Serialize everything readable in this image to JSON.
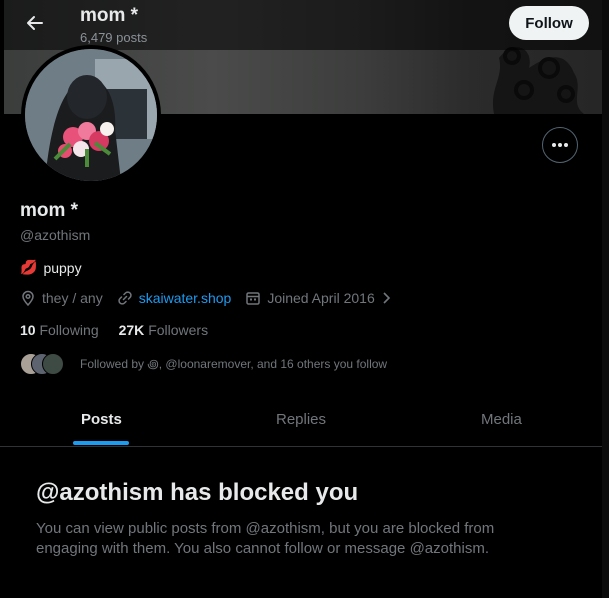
{
  "header": {
    "display_name": "mom *",
    "posts_count": "6,479 posts",
    "follow_label": "Follow"
  },
  "profile": {
    "display_name": "mom *",
    "handle": "@azothism",
    "bio_emoji": "💋",
    "bio_text": "puppy",
    "pronouns": "they / any",
    "website": "skaiwater.shop",
    "joined": "Joined April 2016",
    "following_count": "10",
    "following_label": "Following",
    "followers_count": "27K",
    "followers_label": "Followers",
    "followed_by": "Followed by ꩜, @loonaremover, and 16 others you follow"
  },
  "tabs": [
    {
      "label": "Posts"
    },
    {
      "label": "Replies"
    },
    {
      "label": "Media"
    }
  ],
  "blocked": {
    "title": "@azothism has blocked you",
    "body": "You can view public posts from @azothism, but you are blocked from engaging with them. You also cannot follow or message @azothism."
  },
  "colors": {
    "accent": "#1d9bf0",
    "background": "#000000",
    "muted": "#71767b"
  },
  "icons": [
    "back-arrow-icon",
    "more-icon",
    "location-icon",
    "link-icon",
    "calendar-icon",
    "chevron-right-icon"
  ]
}
